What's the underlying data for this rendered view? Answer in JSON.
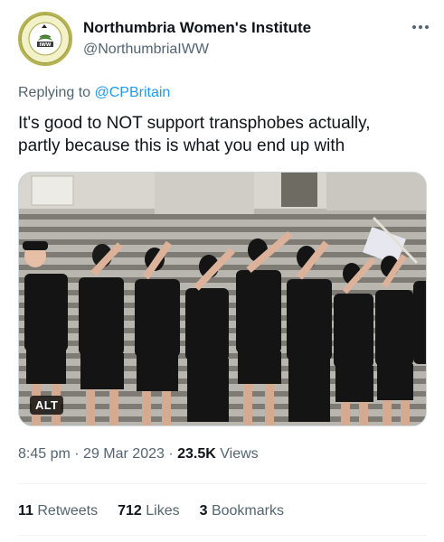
{
  "author": {
    "display_name": "Northumbria Women's Institute",
    "handle": "@NorthumbriaIWW",
    "avatar_text_top": "NORTHUMBRIA",
    "avatar_text_bottom": "BRANCH",
    "avatar_badge": "IWW"
  },
  "reply": {
    "prefix": "Replying to",
    "mention": "@CPBritain"
  },
  "tweet": {
    "text_line1": "It's good to NOT support transphobes actually,",
    "text_line2": "partly because this is what you end up with"
  },
  "media": {
    "alt_label": "ALT"
  },
  "meta": {
    "time": "8:45 pm",
    "date": "29 Mar 2023",
    "views_count": "23.5K",
    "views_label": "Views"
  },
  "stats": {
    "retweets_count": "11",
    "retweets_label": "Retweets",
    "likes_count": "712",
    "likes_label": "Likes",
    "bookmarks_count": "3",
    "bookmarks_label": "Bookmarks"
  },
  "colors": {
    "link": "#1d9bf0",
    "secondary_text": "#536471",
    "primary_text": "#0f1419"
  }
}
